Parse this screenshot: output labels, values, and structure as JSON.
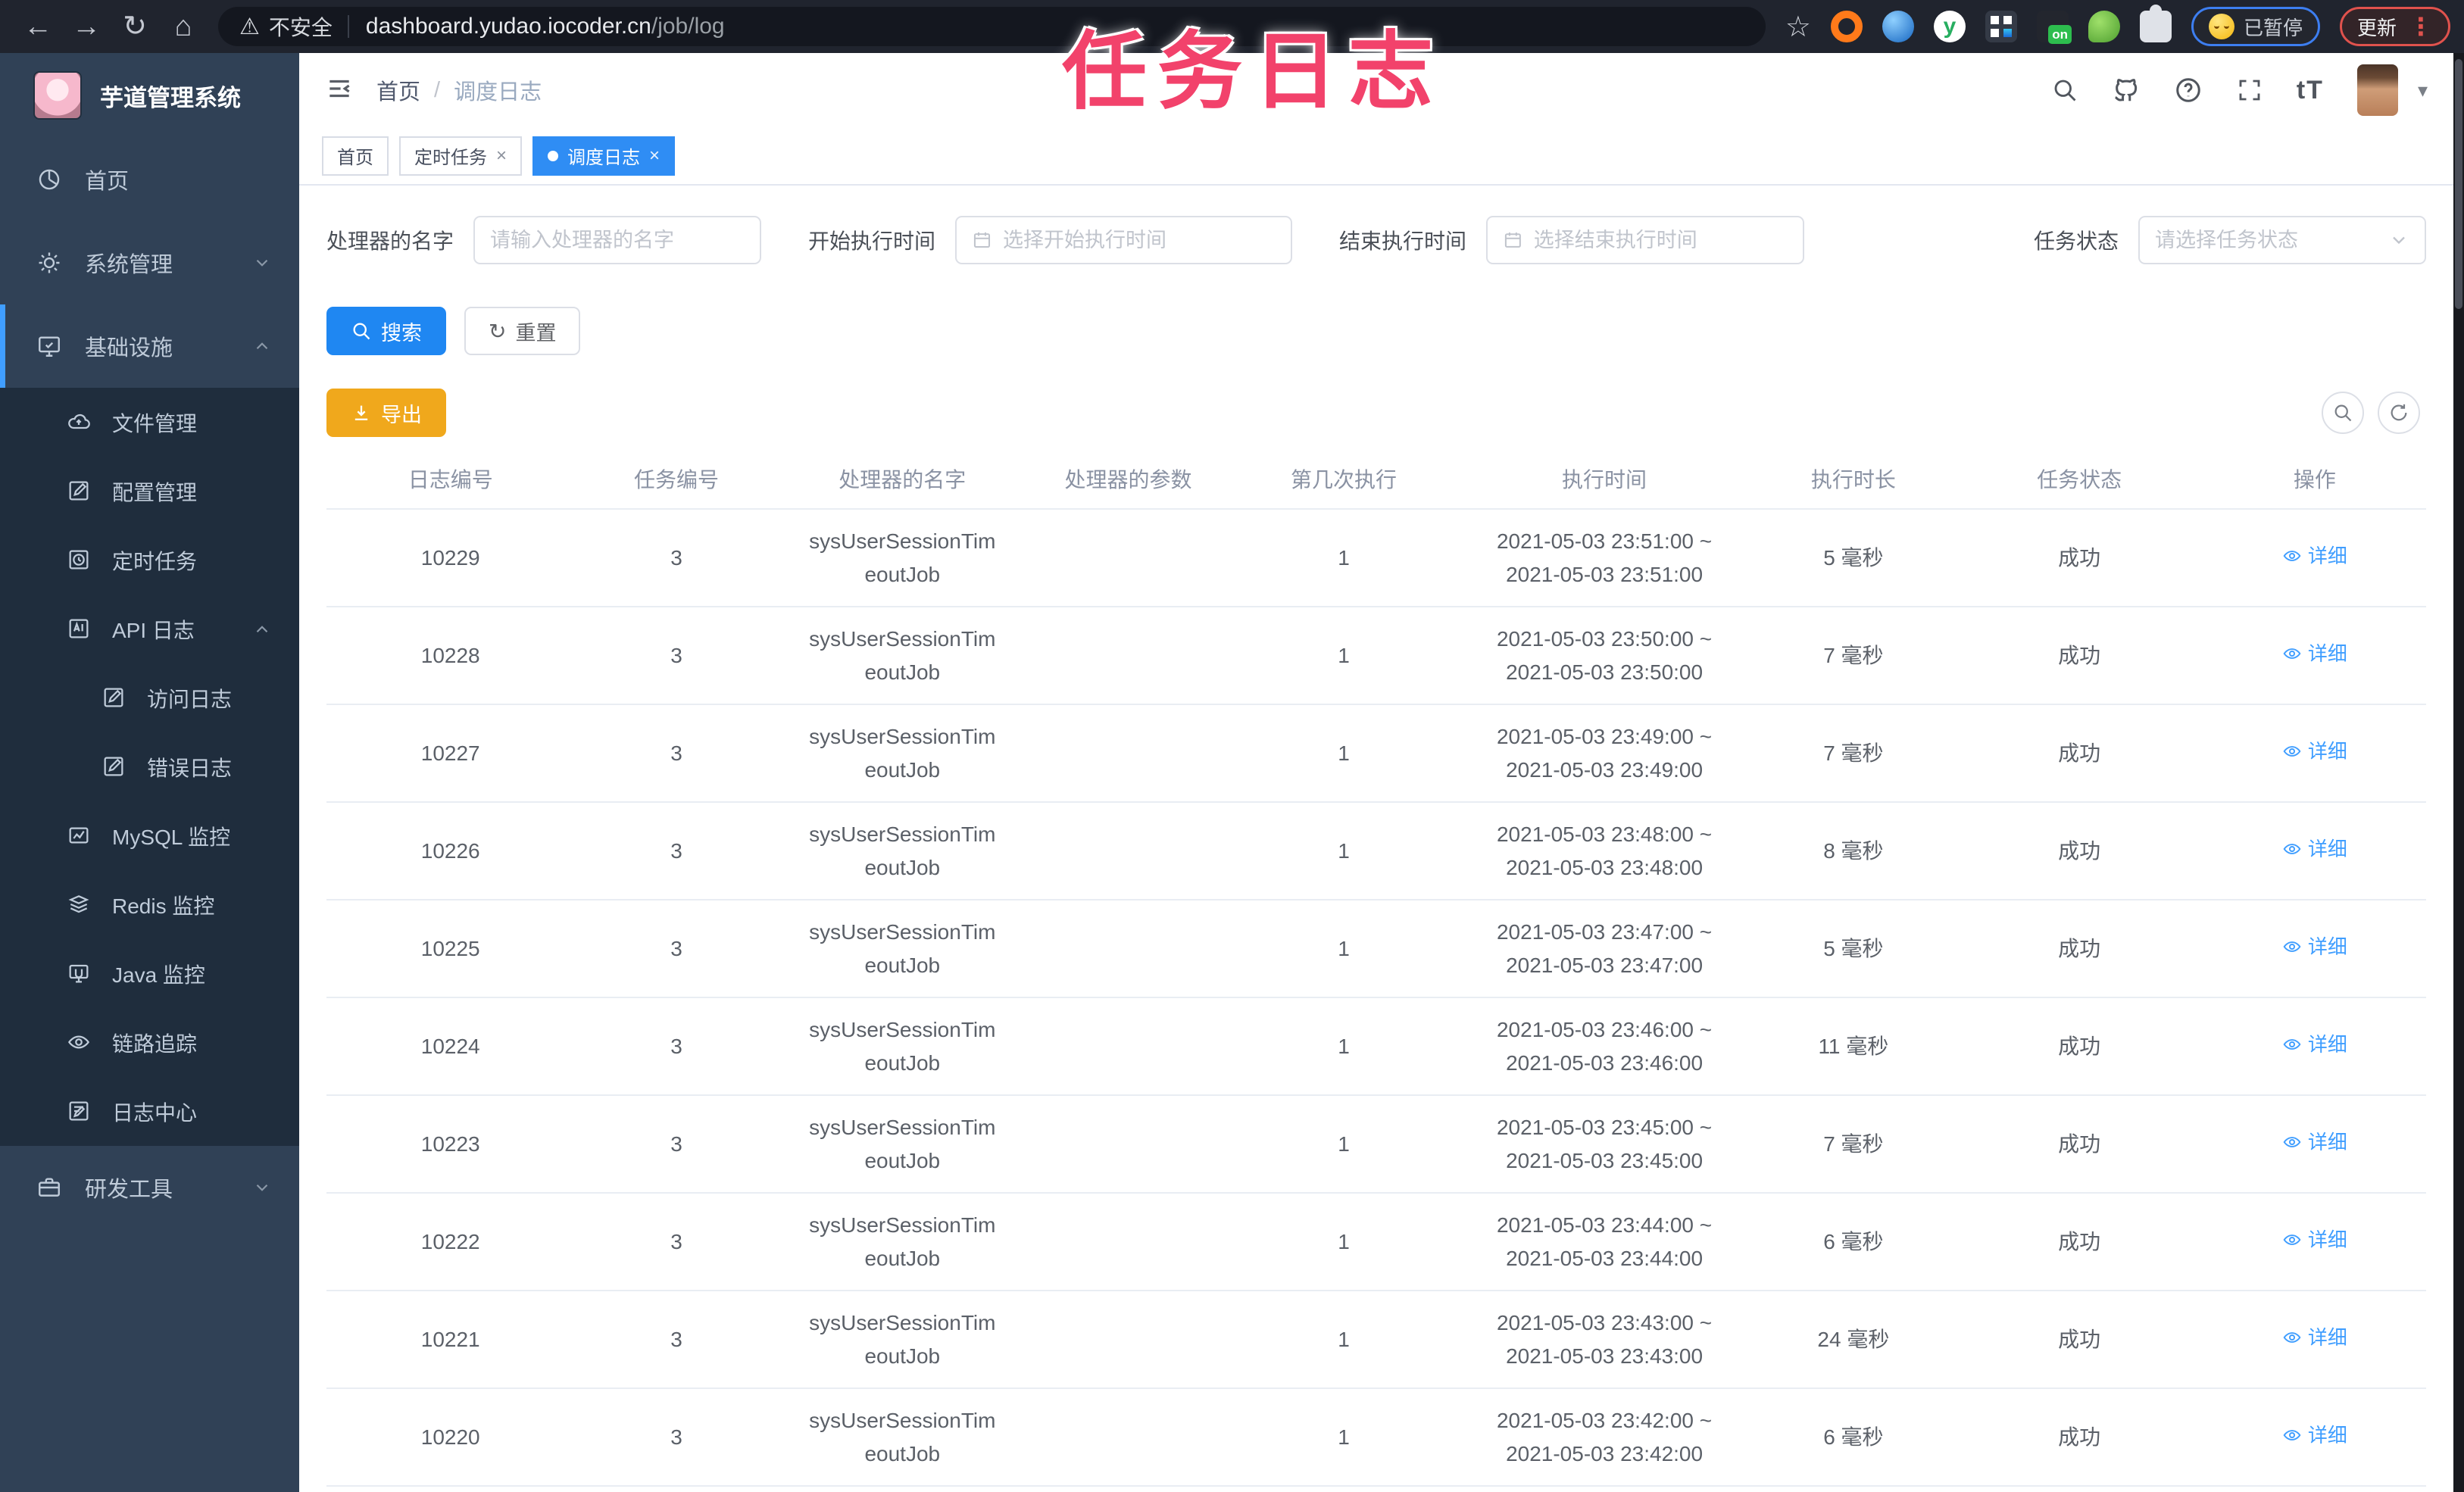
{
  "annotation_text": "任务日志",
  "browser": {
    "nav": {
      "back": "←",
      "forward": "→",
      "reload": "↻",
      "home": "⌂"
    },
    "warning_glyph": "⚠",
    "security_label": "不安全",
    "url_domain": "dashboard.yudao.iocoder.cn",
    "url_path": "/job/log",
    "star_glyph": "☆",
    "ext_on_badge": "on",
    "ext_y_letter": "y",
    "paused_label": "已暂停",
    "update_label": "更新",
    "kebab_glyph": "⋮"
  },
  "sidebar": {
    "title": "芋道管理系统",
    "menu": [
      {
        "label": "首页"
      },
      {
        "label": "系统管理"
      },
      {
        "label": "基础设施"
      }
    ],
    "submenu": [
      {
        "label": "文件管理"
      },
      {
        "label": "配置管理"
      },
      {
        "label": "定时任务"
      },
      {
        "label": "API 日志"
      },
      {
        "label": "访问日志"
      },
      {
        "label": "错误日志"
      },
      {
        "label": "MySQL 监控"
      },
      {
        "label": "Redis 监控"
      },
      {
        "label": "Java 监控"
      },
      {
        "label": "链路追踪"
      },
      {
        "label": "日志中心"
      }
    ],
    "dev_tools_label": "研发工具"
  },
  "header": {
    "breadcrumb": {
      "home": "首页",
      "current": "调度日志"
    },
    "font_icon_text": "tT"
  },
  "ui": {
    "breadcrumb_sep": "/",
    "close_glyph": "×",
    "caret_glyph": "▾",
    "reset_glyph": "↻"
  },
  "tags": [
    {
      "label": "首页"
    },
    {
      "label": "定时任务"
    },
    {
      "label": "调度日志"
    }
  ],
  "filters": {
    "handler_label": "处理器的名字",
    "handler_placeholder": "请输入处理器的名字",
    "begin_label": "开始执行时间",
    "begin_placeholder": "选择开始执行时间",
    "end_label": "结束执行时间",
    "end_placeholder": "选择结束执行时间",
    "status_label": "任务状态",
    "status_placeholder": "请选择任务状态",
    "search_label": "搜索",
    "reset_label": "重置",
    "export_label": "导出"
  },
  "table": {
    "columns": [
      "日志编号",
      "任务编号",
      "处理器的名字",
      "处理器的参数",
      "第几次执行",
      "执行时间",
      "执行时长",
      "任务状态",
      "操作"
    ],
    "rows": [
      {
        "id": "10229",
        "job": "3",
        "handler1": "sysUserSessionTim",
        "handler2": "eoutJob",
        "param": "",
        "count": "1",
        "time1": "2021-05-03 23:51:00 ~",
        "time2": "2021-05-03 23:51:00",
        "duration": "5 毫秒",
        "status": "成功",
        "action": "详细"
      },
      {
        "id": "10228",
        "job": "3",
        "handler1": "sysUserSessionTim",
        "handler2": "eoutJob",
        "param": "",
        "count": "1",
        "time1": "2021-05-03 23:50:00 ~",
        "time2": "2021-05-03 23:50:00",
        "duration": "7 毫秒",
        "status": "成功",
        "action": "详细"
      },
      {
        "id": "10227",
        "job": "3",
        "handler1": "sysUserSessionTim",
        "handler2": "eoutJob",
        "param": "",
        "count": "1",
        "time1": "2021-05-03 23:49:00 ~",
        "time2": "2021-05-03 23:49:00",
        "duration": "7 毫秒",
        "status": "成功",
        "action": "详细"
      },
      {
        "id": "10226",
        "job": "3",
        "handler1": "sysUserSessionTim",
        "handler2": "eoutJob",
        "param": "",
        "count": "1",
        "time1": "2021-05-03 23:48:00 ~",
        "time2": "2021-05-03 23:48:00",
        "duration": "8 毫秒",
        "status": "成功",
        "action": "详细"
      },
      {
        "id": "10225",
        "job": "3",
        "handler1": "sysUserSessionTim",
        "handler2": "eoutJob",
        "param": "",
        "count": "1",
        "time1": "2021-05-03 23:47:00 ~",
        "time2": "2021-05-03 23:47:00",
        "duration": "5 毫秒",
        "status": "成功",
        "action": "详细"
      },
      {
        "id": "10224",
        "job": "3",
        "handler1": "sysUserSessionTim",
        "handler2": "eoutJob",
        "param": "",
        "count": "1",
        "time1": "2021-05-03 23:46:00 ~",
        "time2": "2021-05-03 23:46:00",
        "duration": "11 毫秒",
        "status": "成功",
        "action": "详细"
      },
      {
        "id": "10223",
        "job": "3",
        "handler1": "sysUserSessionTim",
        "handler2": "eoutJob",
        "param": "",
        "count": "1",
        "time1": "2021-05-03 23:45:00 ~",
        "time2": "2021-05-03 23:45:00",
        "duration": "7 毫秒",
        "status": "成功",
        "action": "详细"
      },
      {
        "id": "10222",
        "job": "3",
        "handler1": "sysUserSessionTim",
        "handler2": "eoutJob",
        "param": "",
        "count": "1",
        "time1": "2021-05-03 23:44:00 ~",
        "time2": "2021-05-03 23:44:00",
        "duration": "6 毫秒",
        "status": "成功",
        "action": "详细"
      },
      {
        "id": "10221",
        "job": "3",
        "handler1": "sysUserSessionTim",
        "handler2": "eoutJob",
        "param": "",
        "count": "1",
        "time1": "2021-05-03 23:43:00 ~",
        "time2": "2021-05-03 23:43:00",
        "duration": "24 毫秒",
        "status": "成功",
        "action": "详细"
      },
      {
        "id": "10220",
        "job": "3",
        "handler1": "sysUserSessionTim",
        "handler2": "eoutJob",
        "param": "",
        "count": "1",
        "time1": "2021-05-03 23:42:00 ~",
        "time2": "2021-05-03 23:42:00",
        "duration": "6 毫秒",
        "status": "成功",
        "action": "详细"
      }
    ]
  },
  "colors": {
    "accent": "#409eff",
    "primary_button": "#1f87f2",
    "warning_button": "#f0a81c",
    "annotation": "#f2426b",
    "sidebar_bg": "#304156",
    "submenu_bg": "#1f2d3d",
    "browser_bar_bg": "#20242e"
  }
}
